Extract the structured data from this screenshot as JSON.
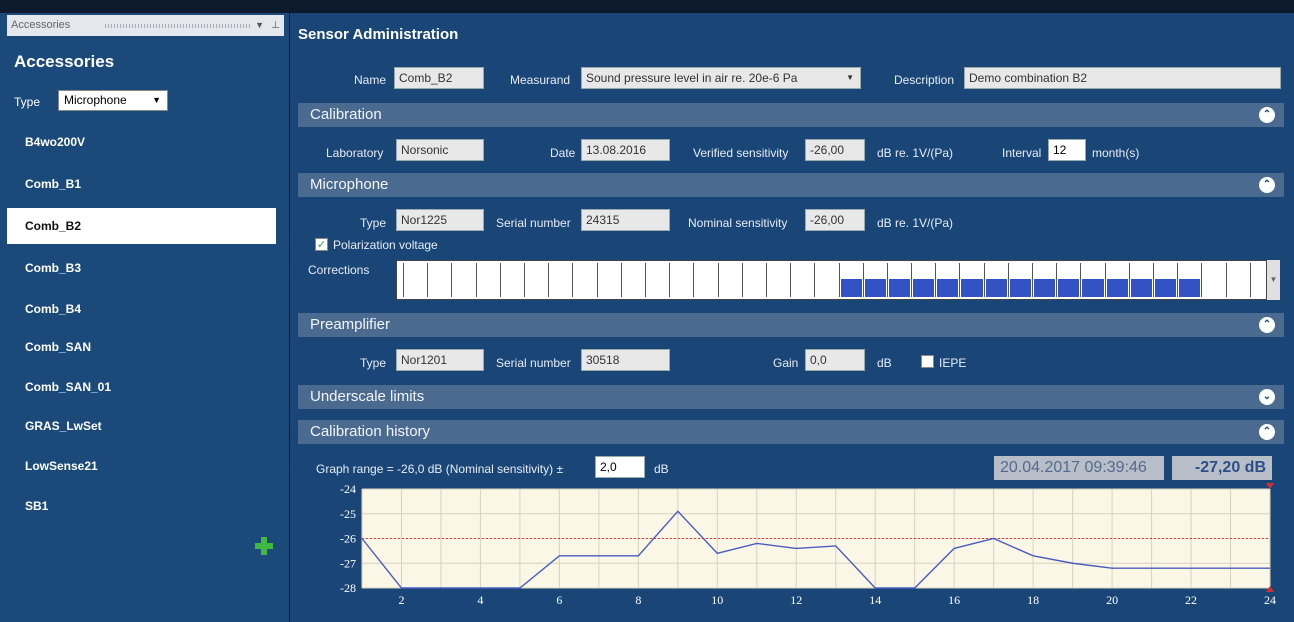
{
  "left_pane": {
    "titlebar": "Accessories",
    "heading": "Accessories",
    "type_label": "Type",
    "type_value": "Microphone",
    "items": [
      "B4wo200V",
      "Comb_B1",
      "Comb_B2",
      "Comb_B3",
      "Comb_B4",
      "Comb_SAN",
      "Comb_SAN_01",
      "GRAS_LwSet",
      "LowSense21",
      "SB1"
    ],
    "selected": "Comb_B2"
  },
  "title": "Sensor Administration",
  "top": {
    "name_label": "Name",
    "name_value": "Comb_B2",
    "measurand_label": "Measurand",
    "measurand_value": "Sound pressure level in air re. 20e-6 Pa",
    "description_label": "Description",
    "description_value": "Demo combination B2"
  },
  "calibration": {
    "header": "Calibration",
    "laboratory_label": "Laboratory",
    "laboratory_value": "Norsonic",
    "date_label": "Date",
    "date_value": "13.08.2016",
    "verified_label": "Verified sensitivity",
    "verified_value": "-26,00",
    "verified_unit": "dB re. 1V/(Pa)",
    "interval_label": "Interval",
    "interval_value": "12",
    "interval_unit": "month(s)"
  },
  "microphone": {
    "header": "Microphone",
    "type_label": "Type",
    "type_value": "Nor1225",
    "serial_label": "Serial number",
    "serial_value": "24315",
    "nominal_label": "Nominal sensitivity",
    "nominal_value": "-26,00",
    "nominal_unit": "dB re. 1V/(Pa)",
    "polarization_label": "Polarization voltage",
    "polarization_checked": true,
    "corrections_label": "Corrections",
    "corrections_total": 36,
    "corrections_filled_from": 18,
    "corrections_filled_to": 32
  },
  "preamplifier": {
    "header": "Preamplifier",
    "type_label": "Type",
    "type_value": "Nor1201",
    "serial_label": "Serial number",
    "serial_value": "30518",
    "gain_label": "Gain",
    "gain_value": "0,0",
    "gain_unit": "dB",
    "iepe_label": "IEPE",
    "iepe_checked": false
  },
  "underscale": {
    "header": "Underscale limits"
  },
  "history": {
    "header": "Calibration history",
    "range_label": "Graph range = -26,0 dB (Nominal sensitivity) ±",
    "range_value": "2,0",
    "range_unit": "dB",
    "timestamp": "20.04.2017 09:39:46",
    "value": "-27,20 dB"
  },
  "colors": {
    "accent_blue": "#3353c4",
    "line": "#4a5cc0",
    "reference": "#d04040"
  },
  "chart_data": {
    "type": "line",
    "x": [
      1,
      2,
      3,
      4,
      5,
      6,
      7,
      8,
      9,
      10,
      11,
      12,
      13,
      14,
      15,
      16,
      17,
      18,
      19,
      20,
      21,
      22,
      23,
      24
    ],
    "values": [
      -26.0,
      -28.0,
      -28.0,
      -28.0,
      -28.0,
      -26.7,
      -26.7,
      -26.7,
      -24.9,
      -26.6,
      -26.2,
      -26.4,
      -26.3,
      -28.0,
      -28.0,
      -26.4,
      -26.0,
      -26.7,
      -27.0,
      -27.2,
      -27.2,
      -27.2,
      -27.2,
      -27.2
    ],
    "reference": -26.0,
    "ylim": [
      -28,
      -24
    ],
    "yticks": [
      -24,
      -25,
      -26,
      -27,
      -28
    ],
    "xticks": [
      2,
      4,
      6,
      8,
      10,
      12,
      14,
      16,
      18,
      20,
      22,
      24
    ],
    "xlim": [
      1,
      24
    ],
    "grid": true
  }
}
